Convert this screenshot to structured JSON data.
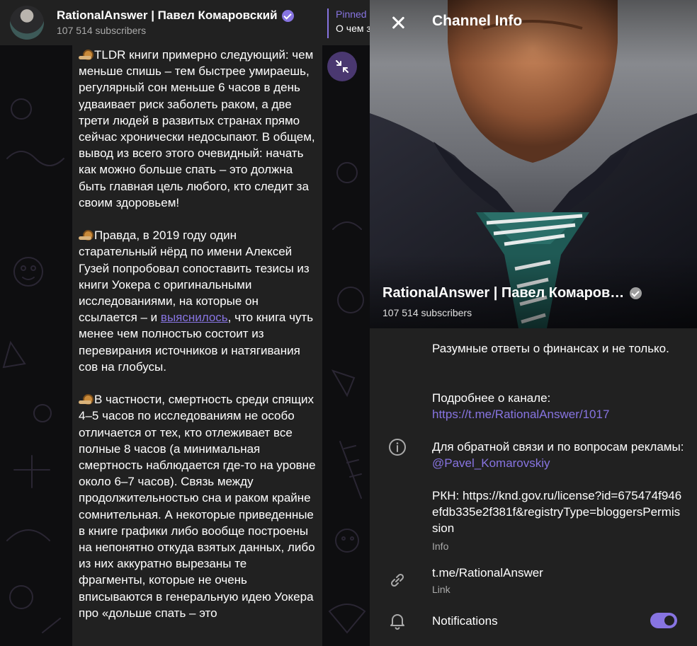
{
  "chat": {
    "title": "RationalAnswer | Павел Комаровский",
    "subscribers": "107 514 subscribers",
    "pinned_title": "Pinned",
    "pinned_text": "О чем з",
    "paragraphs": [
      {
        "before": "TLDR книги примерно следующий: чем меньше спишь – тем быстрее умираешь, регулярный сон меньше 6 часов в день удваивает риск заболеть раком, а две трети людей в развитых странах прямо сейчас хронически недосыпают. В общем, вывод из всего этого очевидный: начать как можно больше спать – это должна быть главная цель любого, кто следит за своим здоровьем!"
      },
      {
        "before": "Правда, в 2019 году один старательный нёрд по имени Алексей Гузей попробовал сопоставить тезисы из книги Уокера с оригинальными исследованиями, на которые он ссылается – и ",
        "link": "выяснилось",
        "after": ", что книга чуть менее чем полностью состоит из перевирания источников и натягивания сов на глобусы."
      },
      {
        "before": "В частности, смертность среди спящих 4–5 часов по исследованиям не особо отличается от тех, кто отлеживает все полные 8 часов (а минимальная смертность наблюдается где-то на уровне около 6–7 часов). Связь между продолжительностью сна и раком крайне сомнительная. А некоторые приведенные в книге графики либо вообще построены на непонятно откуда взятых данных, либо из них аккуратно вырезаны те фрагменты, которые не очень вписываются в генеральную идею Уокера про «дольше спать – это"
      }
    ]
  },
  "info": {
    "header": "Channel Info",
    "name": "RationalAnswer | Павел Комаров…",
    "subscribers": "107 514 subscribers",
    "description_line1": "Разумные ответы о финансах и не только.",
    "more_label": "Подробнее о канале:",
    "more_link": "https://t.me/RationalAnswer/1017",
    "contact_text": "Для обратной связи и по вопросам рекламы: ",
    "contact_handle": "@Pavel_Komarovskiy",
    "rkn_text": "РКН: https://knd.gov.ru/license?id=675474f946efdb335e2f381f&registryType=bloggersPermission",
    "info_caption": "Info",
    "link_value": "t.me/RationalAnswer",
    "link_caption": "Link",
    "notifications_label": "Notifications",
    "notifications_on": true
  },
  "colors": {
    "accent": "#8774e1",
    "panel": "#212121",
    "background": "#0e0e10"
  },
  "icons": {
    "close": "close-icon",
    "info": "info-icon",
    "link": "link-icon",
    "bell": "bell-icon",
    "verified": "verified-badge-icon",
    "scroll_fab": "collapse-arrows-icon"
  }
}
